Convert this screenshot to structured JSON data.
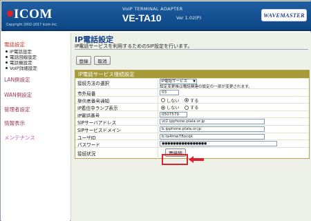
{
  "header": {
    "logo_text": "ICOM",
    "copyright": "Copyright 2002-2017 Icom Inc.",
    "product_line": "VoIP TERMINAL ADAPTER",
    "model": "VE-TA10",
    "version": "Ver 1.02(P)",
    "brand": "WAVEMASTER"
  },
  "sidebar": {
    "groups": [
      {
        "label": "電話設定",
        "active": true,
        "items": [
          "IP電話設定",
          "電話回線設定",
          "電話機設定",
          "VoIP詳細設定"
        ]
      },
      {
        "label": "LAN側設定"
      },
      {
        "label": "WAN側設定"
      },
      {
        "label": "管理者設定"
      },
      {
        "label": "情報表示"
      },
      {
        "label": "メンテナンス"
      }
    ]
  },
  "main": {
    "title": "IP電話設定",
    "description": "IP電話サービスを利用するためのSIP設定を行います。",
    "buttons": {
      "register": "登録",
      "cancel": "取消"
    },
    "section_title": "IP電話サービス接続設定",
    "rows": {
      "connection_method": {
        "label": "接続方法の選択",
        "value": "IP電話サービス",
        "note": "設定変更後は電話関連の設定の一部が変更されます。"
      },
      "outside_prefix": {
        "label": "市外局番",
        "value": "03"
      },
      "caller_id_notify": {
        "label": "発信者番号通知",
        "off": "しない",
        "on": "する",
        "selected": "on"
      },
      "incoming_lamp": {
        "label": "IP着信中ランプ表示",
        "off": "しない",
        "on": "する",
        "selected": "off"
      },
      "ip_phone_number": {
        "label": "IP電話番号",
        "value": "0507579"
      },
      "sip_server_address": {
        "label": "SIPサーバアドレス",
        "value": "vt2.ipphone.plala.or.jp"
      },
      "sip_service_domain": {
        "label": "SIPサービスドメイン",
        "value": "b.ipphone.plala.or.jp"
      },
      "user_id": {
        "label": "ユーザID",
        "value": "b.ta4mw78ocqk"
      },
      "password": {
        "label": "パスワード",
        "value": "●●●●●●●●●●●●●●●●"
      },
      "connection_status": {
        "label": "接続状況",
        "button": "再接続"
      }
    }
  },
  "colors": {
    "header_blue": "#1a5698",
    "section_gold": "#a89a39",
    "highlight_red": "#e0212b"
  }
}
